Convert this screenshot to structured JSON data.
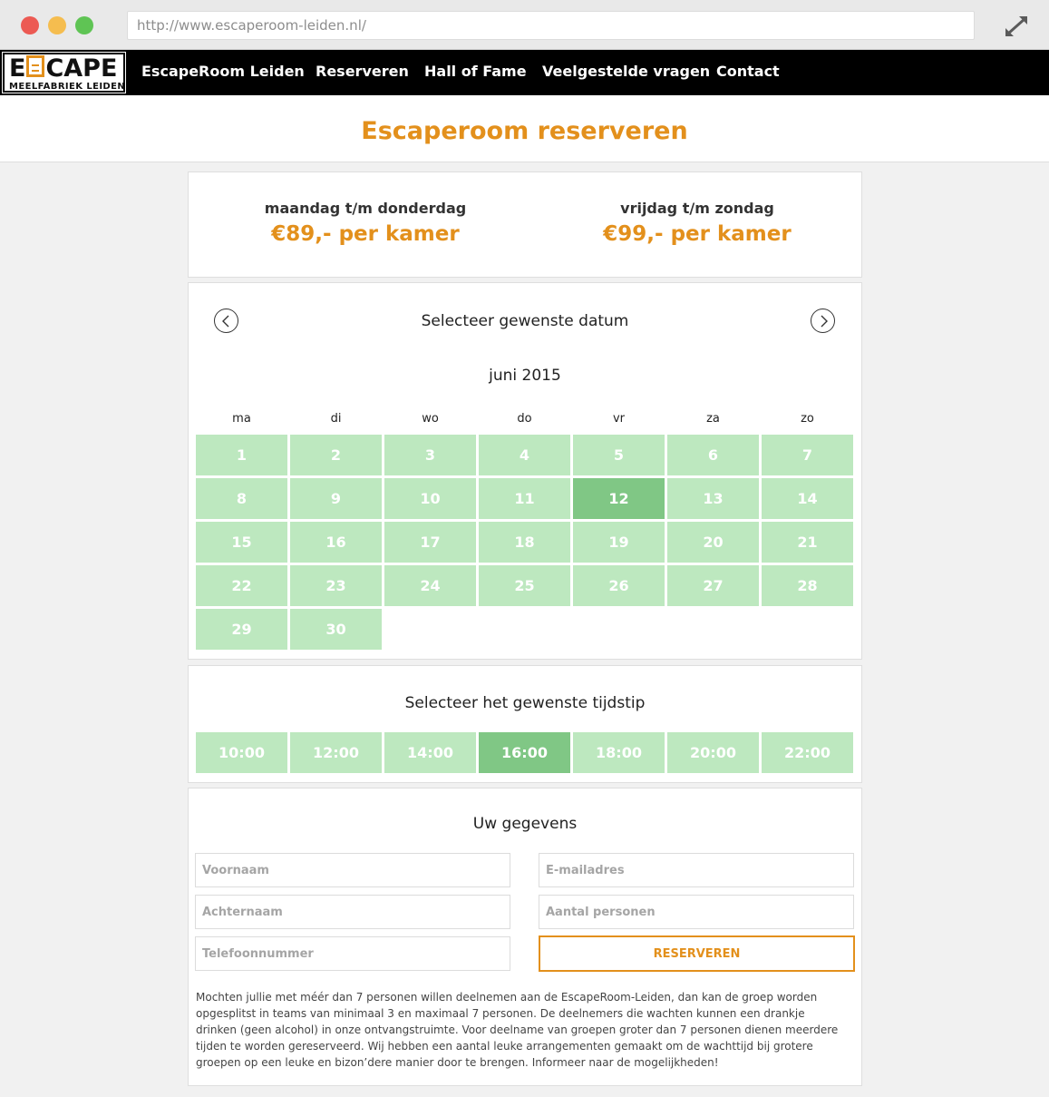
{
  "browser": {
    "url": "http://www.escaperoom-leiden.nl/"
  },
  "logo": {
    "main_left": "E",
    "main_right": "CAPE",
    "sub": "MEELFABRIEK LEIDEN"
  },
  "nav": {
    "items": [
      {
        "label": "EscapeRoom Leiden"
      },
      {
        "label": "Reserveren"
      },
      {
        "label": "Hall of Fame"
      },
      {
        "label": "Veelgestelde vragen"
      },
      {
        "label": "Contact"
      }
    ]
  },
  "page": {
    "title": "Escaperoom reserveren"
  },
  "pricing": {
    "items": [
      {
        "label": "maandag t/m donderdag",
        "price": "€89,- per kamer"
      },
      {
        "label": "vrijdag t/m zondag",
        "price": "€99,- per kamer"
      }
    ]
  },
  "calendar": {
    "title": "Selecteer gewenste datum",
    "month": "juni 2015",
    "weekdays": [
      "ma",
      "di",
      "wo",
      "do",
      "vr",
      "za",
      "zo"
    ],
    "days": [
      "1",
      "2",
      "3",
      "4",
      "5",
      "6",
      "7",
      "8",
      "9",
      "10",
      "11",
      "12",
      "13",
      "14",
      "15",
      "16",
      "17",
      "18",
      "19",
      "20",
      "21",
      "22",
      "23",
      "24",
      "25",
      "26",
      "27",
      "28",
      "29",
      "30"
    ],
    "selected_day": "12",
    "colors": {
      "available": "#bde8bf",
      "selected": "#80c785"
    }
  },
  "time": {
    "title": "Selecteer het gewenste tijdstip",
    "slots": [
      "10:00",
      "12:00",
      "14:00",
      "16:00",
      "18:00",
      "20:00",
      "22:00"
    ],
    "selected": "16:00"
  },
  "form": {
    "title": "Uw gegevens",
    "fields": {
      "first_name": "Voornaam",
      "email": "E-mailadres",
      "last_name": "Achternaam",
      "persons": "Aantal personen",
      "phone": "Telefoonnummer"
    },
    "submit_label": "RESERVEREN",
    "info": "Mochten jullie met méér dan 7 personen willen deelnemen aan de EscapeRoom-Leiden, dan kan de groep worden opgesplitst in teams van minimaal 3 en maximaal 7 personen. De deelnemers die wachten kunnen een drankje drinken (geen alcohol) in onze ontvangstruimte. Voor deelname van groepen groter dan 7 personen dienen meerdere tijden te worden gereserveerd. Wij hebben een aantal leuke arrangementen gemaakt om de wachttijd bij grotere groepen op een leuke en bizon’dere manier door te brengen. Informeer naar de mogelijkheden!"
  },
  "theme": {
    "accent": "#e3901c"
  }
}
